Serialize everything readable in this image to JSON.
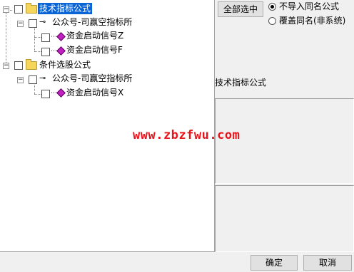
{
  "tree": {
    "groups": [
      {
        "label": "技术指标公式",
        "selected": true,
        "author": "公众号-司赢空指标所",
        "items": [
          "资金启动信号Z",
          "资金启动信号F"
        ]
      },
      {
        "label": "条件选股公式",
        "selected": false,
        "author": "公众号-司赢空指标所",
        "items": [
          "资金启动信号X"
        ]
      }
    ]
  },
  "options": {
    "select_all_label": "全部选中",
    "radio_no_import": "不导入同名公式",
    "radio_overwrite": "覆盖同名(非系统)",
    "selected_radio": "no_import"
  },
  "detail": {
    "title": "技术指标公式"
  },
  "watermark": "www.zbzfwu.com",
  "footer": {
    "ok_label": "确定",
    "cancel_label": "取消"
  },
  "colors": {
    "selection": "#0a64d6",
    "folder": "#f5d65a",
    "gem": "#c020c0",
    "watermark": "#e8141b"
  }
}
